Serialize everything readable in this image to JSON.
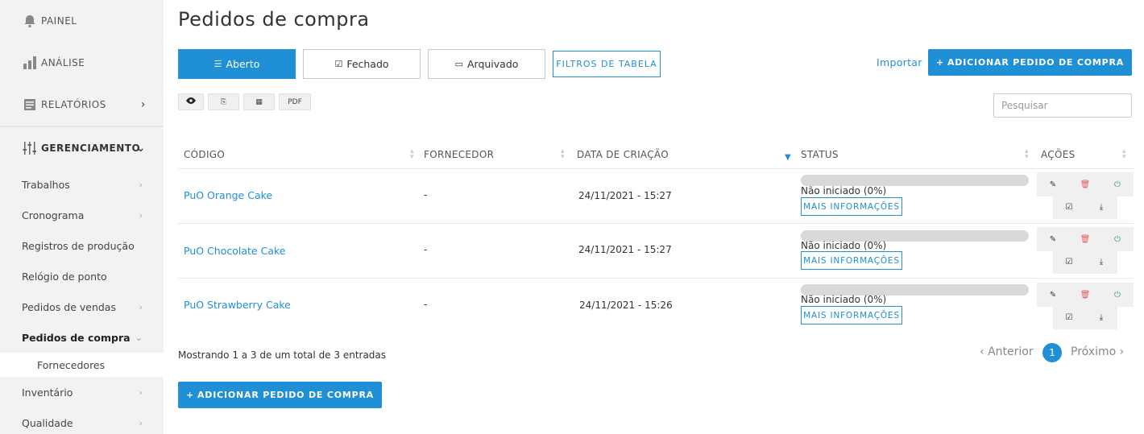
{
  "sidebar": {
    "main_items": [
      {
        "label": "PAINEL",
        "icon": "bell-icon"
      },
      {
        "label": "ANÁLISE",
        "icon": "bar-chart-icon"
      },
      {
        "label": "RELATÓRIOS",
        "icon": "report-icon"
      },
      {
        "label": "GERENCIAMENTO",
        "icon": "sliders-icon"
      }
    ],
    "sub_items": [
      {
        "label": "Trabalhos"
      },
      {
        "label": "Cronograma"
      },
      {
        "label": "Registros de produção"
      },
      {
        "label": "Relógio de ponto"
      },
      {
        "label": "Pedidos de vendas"
      },
      {
        "label": "Pedidos de compra"
      },
      {
        "label": "Fornecedores"
      },
      {
        "label": "Inventário"
      },
      {
        "label": "Qualidade"
      }
    ]
  },
  "page": {
    "title": "Pedidos de compra"
  },
  "tabs": [
    {
      "label": "Aberto",
      "icon": "list-icon"
    },
    {
      "label": "Fechado",
      "icon": "check-square-icon"
    },
    {
      "label": "Arquivado",
      "icon": "inbox-icon"
    }
  ],
  "toolbar": {
    "filters_label": "FILTROS DE TABELA",
    "import_label": "Importar",
    "add_label": "ADICIONAR PEDIDO DE COMPRA",
    "pdf_label": "PDF",
    "search_placeholder": "Pesquisar"
  },
  "table": {
    "columns": [
      "CÓDIGO",
      "FORNECEDOR",
      "DATA DE CRIAÇÃO",
      "STATUS",
      "AÇÕES"
    ],
    "rows": [
      {
        "code": "PuO Orange Cake",
        "supplier": "-",
        "created": "24/11/2021 - 15:27",
        "status": "Não iniciado (0%)",
        "progress": 0,
        "info_label": "MAIS INFORMAÇÕES"
      },
      {
        "code": "PuO Chocolate Cake",
        "supplier": "-",
        "created": "24/11/2021 - 15:27",
        "status": "Não iniciado (0%)",
        "progress": 0,
        "info_label": "MAIS INFORMAÇÕES"
      },
      {
        "code": "PuO Strawberry Cake",
        "supplier": "-",
        "created": "24/11/2021 - 15:26",
        "status": "Não iniciado (0%)",
        "progress": 0,
        "info_label": "MAIS INFORMAÇÕES"
      }
    ]
  },
  "footer": {
    "info": "Mostrando 1 a 3 de um total de 3 entradas",
    "prev_label": "Anterior",
    "next_label": "Próximo",
    "page": "1",
    "add_label": "ADICIONAR PEDIDO DE COMPRA"
  },
  "colors": {
    "accent": "#1f8fd6",
    "delete": "#e25c5c",
    "power": "#3aa35a"
  }
}
